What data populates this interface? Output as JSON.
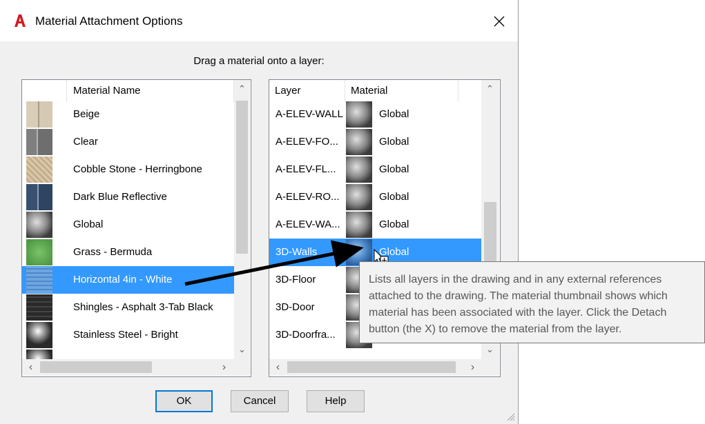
{
  "window": {
    "title": "Material Attachment Options",
    "app_icon": "autocad-logo-icon",
    "close_icon": "close-icon",
    "accent_color": "#3399ff",
    "logo_color": "#d11c23"
  },
  "instruction": "Drag a material onto a layer:",
  "materials_list": {
    "column_header": "Material Name",
    "items": [
      {
        "name": "Beige",
        "thumbnail": "beige-swatch-icon"
      },
      {
        "name": "Clear",
        "thumbnail": "clear-glass-swatch-icon"
      },
      {
        "name": "Cobble Stone - Herringbone",
        "thumbnail": "cobblestone-swatch-icon"
      },
      {
        "name": "Dark Blue Reflective",
        "thumbnail": "dark-blue-swatch-icon"
      },
      {
        "name": "Global",
        "thumbnail": "global-sphere-icon"
      },
      {
        "name": "Grass - Bermuda",
        "thumbnail": "grass-swatch-icon"
      },
      {
        "name": "Horizontal 4in - White",
        "thumbnail": "siding-swatch-icon",
        "selected": true
      },
      {
        "name": "Shingles - Asphalt 3-Tab Black",
        "thumbnail": "shingles-swatch-icon"
      },
      {
        "name": "Stainless Steel - Bright",
        "thumbnail": "steel-sphere-icon"
      }
    ]
  },
  "layers_list": {
    "column_headers": [
      "Layer",
      "Material"
    ],
    "items": [
      {
        "layer": "A-ELEV-WALL",
        "material": "Global"
      },
      {
        "layer": "A-ELEV-FO...",
        "material": "Global"
      },
      {
        "layer": "A-ELEV-FL...",
        "material": "Global"
      },
      {
        "layer": "A-ELEV-RO...",
        "material": "Global"
      },
      {
        "layer": "A-ELEV-WA...",
        "material": "Global"
      },
      {
        "layer": "3D-Walls",
        "material": "Global",
        "selected": true
      },
      {
        "layer": "3D-Floor",
        "material": ""
      },
      {
        "layer": "3D-Door",
        "material": ""
      },
      {
        "layer": "3D-Doorfra...",
        "material": ""
      }
    ]
  },
  "tooltip": {
    "lines": [
      "Lists all layers in the drawing and in any external references",
      "attached to the drawing. The material thumbnail shows which",
      "material has been associated with the layer. Click the Detach",
      "button (the X) to remove the material from the layer."
    ]
  },
  "buttons": {
    "ok": "OK",
    "cancel": "Cancel",
    "help": "Help"
  }
}
